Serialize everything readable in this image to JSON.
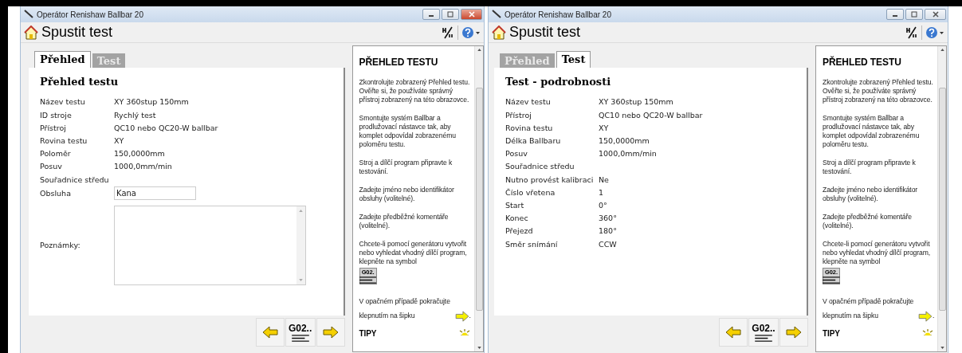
{
  "windows": [
    {
      "title": "Operátor Renishaw Ballbar 20",
      "active": true,
      "heading": "Spustit test",
      "tabs": [
        {
          "label": "Přehled",
          "selected": true
        },
        {
          "label": "Test",
          "selected": false
        }
      ],
      "panel_title": "Přehled testu",
      "rows": [
        {
          "label": "Název testu",
          "value": "XY 360stup 150mm"
        },
        {
          "label": "ID stroje",
          "value": "Rychlý test"
        },
        {
          "label": "Přístroj",
          "value": "QC10 nebo QC20-W ballbar"
        },
        {
          "label": "Rovina testu",
          "value": "XY"
        },
        {
          "label": "Poloměr",
          "value": "150,0000mm"
        },
        {
          "label": "Posuv",
          "value": "1000,0mm/min"
        },
        {
          "label": "Souřadnice středu"
        }
      ],
      "operator": {
        "label": "Obsluha",
        "value": "Kana"
      },
      "notes": {
        "label": "Poznámky:"
      },
      "help": {
        "title": "PŘEHLED TESTU",
        "paragraphs": [
          {
            "text": "Zkontrolujte zobrazený Přehled testu. Ověřte si, že používáte správný přístroj zobrazený na této obrazovce."
          },
          {
            "text": "Smontujte systém Ballbar a prodlužovací nástavce tak, aby komplet odpovídal zobrazenému poloměru testu."
          },
          {
            "text": "Stroj a dílčí program připravte k testování."
          },
          {
            "text": "Zadejte jméno nebo identifikátor obsluhy (volitelné)."
          },
          {
            "text": "Zadejte předběžné komentáře (volitelné)."
          },
          {
            "kind": "g02",
            "text": "Chcete-li pomocí generátoru vytvořit nebo vyhledat vhodný dílčí program, klepněte na symbol",
            "icon_label": "G02."
          },
          {
            "kind": "arrow",
            "text": "V opačném případě pokračujte klepnutím na šipku",
            "after": "."
          }
        ],
        "tips": "TIPY"
      },
      "g02_button": "G02.."
    },
    {
      "title": "Operátor Renishaw Ballbar 20",
      "active": false,
      "heading": "Spustit test",
      "tabs": [
        {
          "label": "Přehled",
          "selected": false
        },
        {
          "label": "Test",
          "selected": true
        }
      ],
      "panel_title": "Test - podrobnosti",
      "rows": [
        {
          "label": "Název testu",
          "value": "XY 360stup 150mm"
        },
        {
          "label": "Přístroj",
          "value": "QC10 nebo QC20-W ballbar"
        },
        {
          "label": "Rovina testu",
          "value": "XY"
        },
        {
          "label": "Délka Ballbaru",
          "value": "150,0000mm"
        },
        {
          "label": "Posuv",
          "value": "1000,0mm/min"
        },
        {
          "label": "Souřadnice středu"
        },
        {
          "label": "Nutno provést kalibraci",
          "value": "Ne"
        },
        {
          "label": "Číslo vřetena",
          "value": "1"
        },
        {
          "label": "Start",
          "value": "0°"
        },
        {
          "label": "Konec",
          "value": "360°"
        },
        {
          "label": "Přejezd",
          "value": "180°"
        },
        {
          "label": "Směr snímání",
          "value": "CCW"
        }
      ],
      "help": {
        "title": "PŘEHLED TESTU",
        "paragraphs": [
          {
            "text": "Zkontrolujte zobrazený Přehled testu. Ověřte si, že používáte správný přístroj zobrazený na této obrazovce."
          },
          {
            "text": "Smontujte systém Ballbar a prodlužovací nástavce tak, aby komplet odpovídal zobrazenému poloměru testu."
          },
          {
            "text": "Stroj a dílčí program připravte k testování."
          },
          {
            "text": "Zadejte jméno nebo identifikátor obsluhy (volitelné)."
          },
          {
            "text": "Zadejte předběžné komentáře (volitelné)."
          },
          {
            "kind": "g02",
            "text": "Chcete-li pomocí generátoru vytvořit nebo vyhledat vhodný dílčí program, klepněte na symbol",
            "icon_label": "G02."
          },
          {
            "kind": "arrow",
            "text": "V opačném případě pokračujte klepnutím na šipku",
            "after": "."
          }
        ],
        "tips": "TIPY"
      },
      "g02_button": "G02.."
    }
  ]
}
